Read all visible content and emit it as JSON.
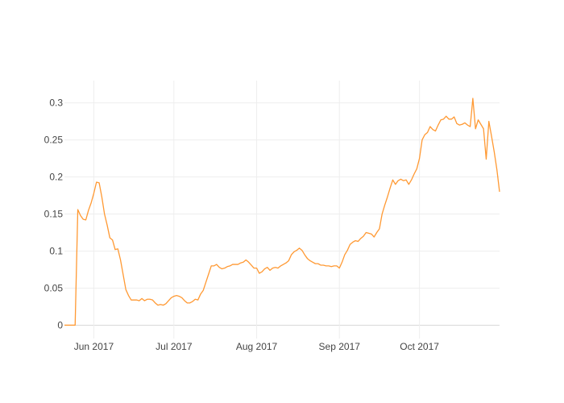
{
  "chart_data": {
    "type": "line",
    "title": "",
    "xlabel": "",
    "ylabel": "",
    "x_start": "2017-05-21",
    "x_end": "2017-10-31",
    "xlim": [
      "2017-05-21",
      "2017-10-31"
    ],
    "ylim": [
      -0.018,
      0.33
    ],
    "y_ticks": [
      0,
      0.05,
      0.1,
      0.15,
      0.2,
      0.25,
      0.3
    ],
    "y_tick_labels": [
      "0",
      "0.05",
      "0.1",
      "0.15",
      "0.2",
      "0.25",
      "0.3"
    ],
    "x_ticks": [
      "2017-06-01",
      "2017-07-01",
      "2017-08-01",
      "2017-09-01",
      "2017-10-01"
    ],
    "x_tick_labels": [
      "Jun 2017",
      "Jul 2017",
      "Aug 2017",
      "Sep 2017",
      "Oct 2017"
    ],
    "grid": true,
    "legend": "none",
    "line_color": "#ff9933",
    "series": [
      {
        "values": [
          0,
          0,
          0,
          0,
          0,
          0.156,
          0.148,
          0.143,
          0.142,
          0.155,
          0.165,
          0.178,
          0.193,
          0.192,
          0.173,
          0.15,
          0.135,
          0.118,
          0.115,
          0.102,
          0.103,
          0.088,
          0.068,
          0.048,
          0.04,
          0.034,
          0.034,
          0.034,
          0.033,
          0.036,
          0.033,
          0.035,
          0.035,
          0.034,
          0.03,
          0.027,
          0.028,
          0.027,
          0.029,
          0.033,
          0.037,
          0.039,
          0.04,
          0.039,
          0.037,
          0.033,
          0.03,
          0.03,
          0.032,
          0.035,
          0.034,
          0.042,
          0.047,
          0.058,
          0.069,
          0.08,
          0.08,
          0.082,
          0.078,
          0.076,
          0.077,
          0.079,
          0.08,
          0.082,
          0.082,
          0.082,
          0.084,
          0.085,
          0.088,
          0.085,
          0.081,
          0.077,
          0.077,
          0.07,
          0.072,
          0.076,
          0.078,
          0.074,
          0.077,
          0.078,
          0.077,
          0.08,
          0.082,
          0.084,
          0.087,
          0.095,
          0.099,
          0.101,
          0.104,
          0.101,
          0.095,
          0.09,
          0.087,
          0.085,
          0.083,
          0.083,
          0.081,
          0.081,
          0.08,
          0.08,
          0.079,
          0.08,
          0.08,
          0.077,
          0.085,
          0.095,
          0.101,
          0.109,
          0.112,
          0.114,
          0.113,
          0.117,
          0.12,
          0.125,
          0.124,
          0.123,
          0.119,
          0.125,
          0.13,
          0.15,
          0.162,
          0.173,
          0.185,
          0.196,
          0.19,
          0.195,
          0.197,
          0.195,
          0.196,
          0.19,
          0.196,
          0.204,
          0.211,
          0.225,
          0.25,
          0.257,
          0.26,
          0.268,
          0.264,
          0.262,
          0.27,
          0.277,
          0.278,
          0.282,
          0.278,
          0.278,
          0.281,
          0.272,
          0.27,
          0.271,
          0.273,
          0.27,
          0.268,
          0.306,
          0.265,
          0.277,
          0.271,
          0.265,
          0.224,
          0.275,
          0.255,
          0.234,
          0.21,
          0.18
        ]
      }
    ]
  }
}
